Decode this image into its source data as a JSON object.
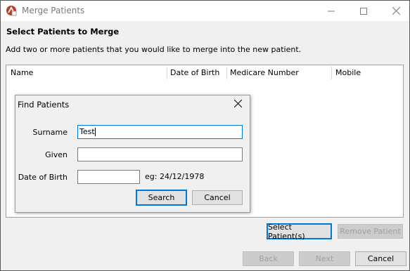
{
  "window": {
    "title": "Merge Patients"
  },
  "page": {
    "heading": "Select Patients to Merge",
    "instruction": "Add two or more patients that you would like to merge into the new patient."
  },
  "grid": {
    "columns": [
      "Name",
      "Date of Birth",
      "Medicare Number",
      "Mobile"
    ]
  },
  "dialog": {
    "title": "Find Patients",
    "surname_label": "Surname",
    "surname_value": "Test",
    "given_label": "Given",
    "given_value": "",
    "dob_label": "Date of Birth",
    "dob_value": "",
    "dob_hint": "eg: 24/12/1978",
    "search_label": "Search",
    "cancel_label": "Cancel"
  },
  "actions": {
    "select_label": "Select Patient(s)",
    "remove_label": "Remove Patient"
  },
  "footer": {
    "back_label": "Back",
    "next_label": "Next",
    "cancel_label": "Cancel"
  }
}
